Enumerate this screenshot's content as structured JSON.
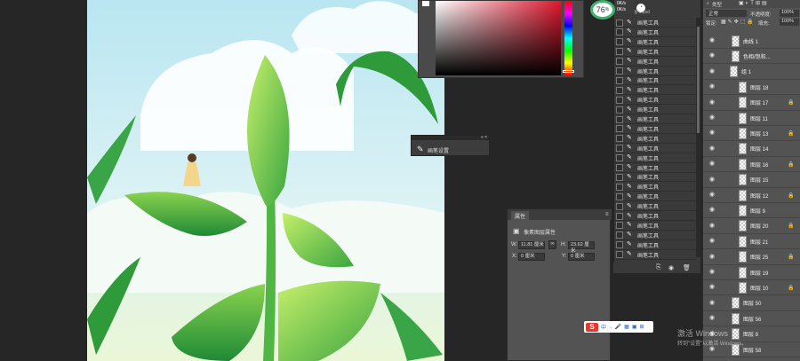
{
  "zoom": {
    "value": "76",
    "unit": "%"
  },
  "net": {
    "up": "0K/s",
    "down": "0K/s"
  },
  "history": {
    "header": "插画-1.psd",
    "items": [
      "画笔工具",
      "画笔工具",
      "画笔工具",
      "画笔工具",
      "画笔工具",
      "画笔工具",
      "画笔工具",
      "画笔工具",
      "画笔工具",
      "画笔工具",
      "画笔工具",
      "画笔工具",
      "画笔工具",
      "画笔工具",
      "画笔工具",
      "画笔工具",
      "画笔工具",
      "画笔工具",
      "画笔工具",
      "画笔工具",
      "画笔工具",
      "画笔工具",
      "画笔工具",
      "画笔工具",
      "画笔工具",
      "画笔工具"
    ]
  },
  "brush_panel": {
    "label": "画笔设置"
  },
  "properties": {
    "tab": "属性",
    "title": "像素图层属性",
    "w_label": "W:",
    "w_value": "11.81 厘米",
    "h_label": "H:",
    "h_value": "23.62 厘米",
    "x_label": "X:",
    "x_value": "0 厘米",
    "y_label": "Y:",
    "y_value": "0 厘米"
  },
  "layers_panel": {
    "search": "类型",
    "blend_mode": "正常",
    "opacity_label": "不透明度:",
    "opacity_value": "100%",
    "lock_label": "锁定:",
    "fill_label": "填充:",
    "fill_value": "100%",
    "layers": [
      {
        "name": "曲线 1"
      },
      {
        "name": "色相/饱和..."
      },
      {
        "name": "组 1"
      },
      {
        "name": "图层 18"
      },
      {
        "name": "图层 17"
      },
      {
        "name": "图层 11"
      },
      {
        "name": "图层 13"
      },
      {
        "name": "图层 14"
      },
      {
        "name": "图层 16"
      },
      {
        "name": "图层 15"
      },
      {
        "name": "图层 12"
      },
      {
        "name": "图层 9"
      },
      {
        "name": "图层 20"
      },
      {
        "name": "图层 21"
      },
      {
        "name": "图层 25"
      },
      {
        "name": "图层 19"
      },
      {
        "name": "图层 10"
      },
      {
        "name": "图层 50"
      },
      {
        "name": "图层 56"
      },
      {
        "name": "图层 8"
      },
      {
        "name": "图层 58"
      }
    ]
  },
  "ime": {
    "items": [
      "中",
      "·,",
      "🎤",
      "▦",
      "▣",
      "⊞"
    ]
  },
  "watermark": {
    "line1": "激活 Windows",
    "line2": "转到\"设置\"以激活 Windows。"
  },
  "colors": {
    "sky_top": "#cfeef4",
    "sky_bottom": "#e7f5e0",
    "leaf_dark": "#2f9a3a",
    "leaf_light": "#a8e05a"
  }
}
